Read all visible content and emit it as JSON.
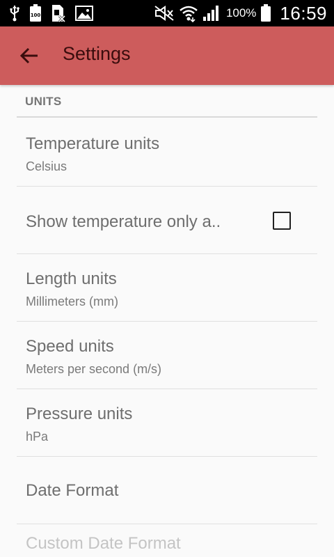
{
  "status_bar": {
    "icons_left": [
      "usb-icon",
      "battery-100-icon",
      "sim-icon",
      "image-icon"
    ],
    "icons_right": [
      "mute-icon",
      "wifi-icon",
      "signal-icon"
    ],
    "battery_text": "100%",
    "time": "16:59"
  },
  "app_bar": {
    "title": "Settings",
    "back_icon": "arrow-back-icon",
    "color": "#cd5c5c"
  },
  "section": {
    "header": "UNITS"
  },
  "preferences": [
    {
      "title": "Temperature units",
      "summary": "Celsius"
    },
    {
      "title": "Show temperature only a..",
      "checked": false
    },
    {
      "title": "Length units",
      "summary": "Millimeters (mm)"
    },
    {
      "title": "Speed units",
      "summary": "Meters per second (m/s)"
    },
    {
      "title": "Pressure units",
      "summary": "hPa"
    },
    {
      "title": "Date Format"
    },
    {
      "title": "Custom Date Format",
      "enabled": false
    }
  ]
}
